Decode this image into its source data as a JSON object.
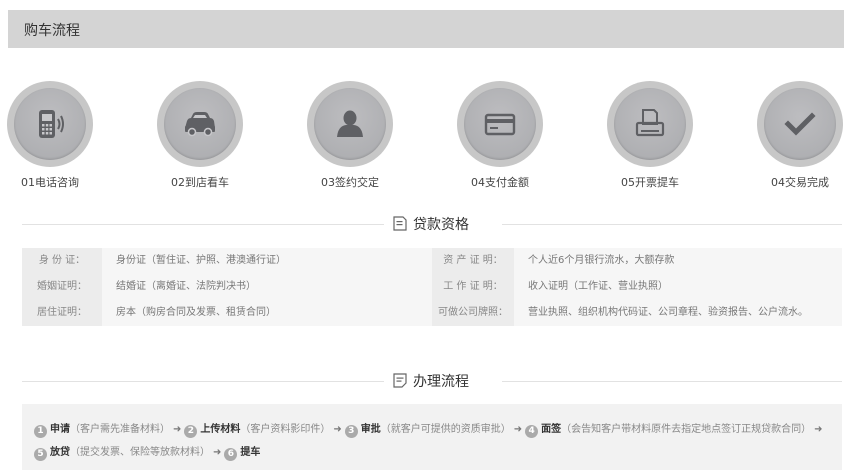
{
  "header": {
    "title": "购车流程"
  },
  "steps": [
    {
      "label": "01电话咨询",
      "icon": "phone-icon"
    },
    {
      "label": "02到店看车",
      "icon": "car-icon"
    },
    {
      "label": "03签约交定",
      "icon": "person-icon"
    },
    {
      "label": "04支付金额",
      "icon": "card-icon"
    },
    {
      "label": "05开票提车",
      "icon": "printer-icon"
    },
    {
      "label": "04交易完成",
      "icon": "check-icon"
    }
  ],
  "loan_section": {
    "title": "贷款资格"
  },
  "qualifications": [
    {
      "left_key": "身 份 证：",
      "left_value": "身份证（暂住证、护照、港澳通行证）",
      "right_key": "资 产 证 明：",
      "right_value": "个人近6个月银行流水，大额存款"
    },
    {
      "left_key": "婚姻证明：",
      "left_value": "结婚证（离婚证、法院判决书）",
      "right_key": "工 作 证 明：",
      "right_value": "收入证明（工作证、营业执照）"
    },
    {
      "left_key": "居住证明：",
      "left_value": "房本（购房合同及发票、租赁合同）",
      "right_key": "可做公司牌照：",
      "right_value": "营业执照、组织机构代码证、公司章程、验资报告、公户流水。"
    }
  ],
  "process_section": {
    "title": "办理流程"
  },
  "process": [
    {
      "num": "1",
      "name": "申请",
      "desc": "（客户需先准备材料）"
    },
    {
      "num": "2",
      "name": "上传材料",
      "desc": "（客户资料影印件）"
    },
    {
      "num": "3",
      "name": "审批",
      "desc": "（就客户可提供的资质审批）"
    },
    {
      "num": "4",
      "name": "面签",
      "desc": "（会告知客户带材料原件去指定地点签订正规贷款合同）"
    },
    {
      "num": "5",
      "name": "放贷",
      "desc": "（提交发票、保险等放款材料）"
    },
    {
      "num": "6",
      "name": "提车",
      "desc": ""
    }
  ],
  "colors": {
    "header_bg": "#d4d4d4",
    "circle": "#a9aaad",
    "icon": "#5f6064"
  }
}
